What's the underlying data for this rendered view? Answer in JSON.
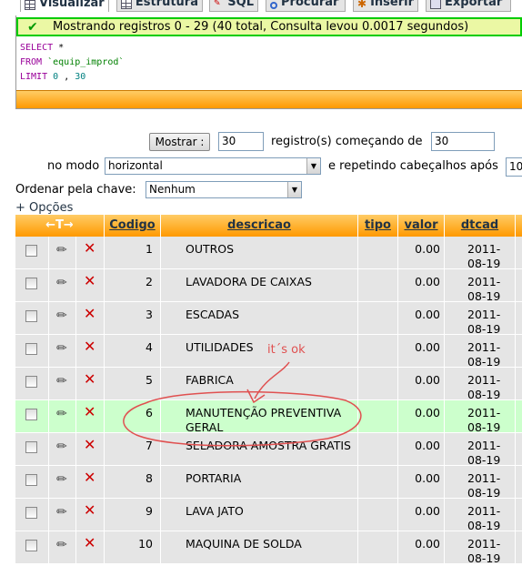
{
  "tabs": [
    {
      "label": "Visualizar",
      "icon": "browse-icon",
      "active": true
    },
    {
      "label": "Estrutura",
      "icon": "structure-icon"
    },
    {
      "label": "SQL",
      "icon": "sql-icon"
    },
    {
      "label": "Procurar",
      "icon": "search-icon"
    },
    {
      "label": "Inserir",
      "icon": "insert-icon"
    },
    {
      "label": "Exportar",
      "icon": "export-icon"
    }
  ],
  "message": {
    "text": "Mostrando registros 0 - 29 (40 total, Consulta levou 0.0017 segundos)",
    "color": "#00cc00"
  },
  "sql": {
    "select": "SELECT",
    "star": "*",
    "from": "FROM",
    "table": "`equip_improd`",
    "limit": "LIMIT",
    "offset": "0",
    "comma": ",",
    "count": "30"
  },
  "nav": {
    "show_button": "Mostrar :",
    "rows_value": "30",
    "rows_label": "registro(s) começando de",
    "start_value": "30",
    "mode_label": "no modo",
    "mode_value": "horizontal",
    "repeat_label": "e repetindo cabeçalhos após",
    "repeat_value": "10",
    "order_label": "Ordenar pela chave:",
    "order_value": "Nenhum",
    "options_link": "+ Opções"
  },
  "table": {
    "columns": [
      "Codigo",
      "descricao",
      "tipo",
      "valor",
      "dtcad"
    ],
    "rows": [
      {
        "codigo": "1",
        "descricao": "OUTROS",
        "tipo": "",
        "valor": "0.00",
        "dtcad": "2011-08-19"
      },
      {
        "codigo": "2",
        "descricao": "LAVADORA DE CAIXAS",
        "tipo": "",
        "valor": "0.00",
        "dtcad": "2011-08-19"
      },
      {
        "codigo": "3",
        "descricao": "ESCADAS",
        "tipo": "",
        "valor": "0.00",
        "dtcad": "2011-08-19"
      },
      {
        "codigo": "4",
        "descricao": "UTILIDADES",
        "tipo": "",
        "valor": "0.00",
        "dtcad": "2011-08-19"
      },
      {
        "codigo": "5",
        "descricao": "FABRICA",
        "tipo": "",
        "valor": "0.00",
        "dtcad": "2011-08-19"
      },
      {
        "codigo": "6",
        "descricao": "MANUTENÇÃO PREVENTIVA GERAL",
        "tipo": "",
        "valor": "0.00",
        "dtcad": "2011-08-19",
        "highlight": true
      },
      {
        "codigo": "7",
        "descricao": "SELADORA AMOSTRA GRATIS",
        "tipo": "",
        "valor": "0.00",
        "dtcad": "2011-08-19"
      },
      {
        "codigo": "8",
        "descricao": "PORTARIA",
        "tipo": "",
        "valor": "0.00",
        "dtcad": "2011-08-19"
      },
      {
        "codigo": "9",
        "descricao": "LAVA JATO",
        "tipo": "",
        "valor": "0.00",
        "dtcad": "2011-08-19"
      },
      {
        "codigo": "10",
        "descricao": "MAQUINA DE SOLDA",
        "tipo": "",
        "valor": "0.00",
        "dtcad": "2011-08-19"
      }
    ],
    "row_color": "#e5e5e5",
    "highlight_color": "#ccffcc",
    "header_color": "#ff9900"
  },
  "annotation": {
    "text": "it´s ok",
    "color": "#e05050"
  }
}
